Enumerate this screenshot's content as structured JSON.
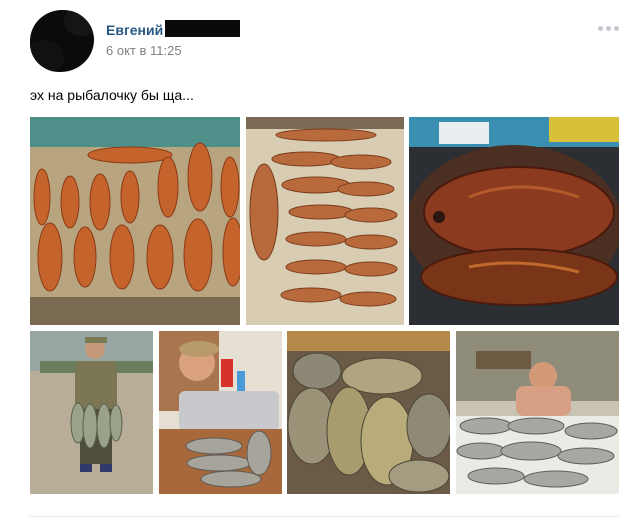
{
  "post": {
    "author": "Евгений",
    "date": "6 окт в 11:25",
    "text": "эх на рыбалочку бы ща...",
    "menu_icon": "more-horizontal-icon"
  },
  "photos": [
    {
      "subject": "dried-fish-laid-out"
    },
    {
      "subject": "smoked-fish-rows"
    },
    {
      "subject": "smoked-carp-on-grill"
    },
    {
      "subject": "man-with-catch"
    },
    {
      "subject": "boy-with-fish-in-sink"
    },
    {
      "subject": "carp-pile"
    },
    {
      "subject": "man-with-catch-on-table"
    }
  ],
  "colors": {
    "author_link": "#2a5885",
    "date_text": "#828282",
    "divider": "#e7e8ec"
  }
}
